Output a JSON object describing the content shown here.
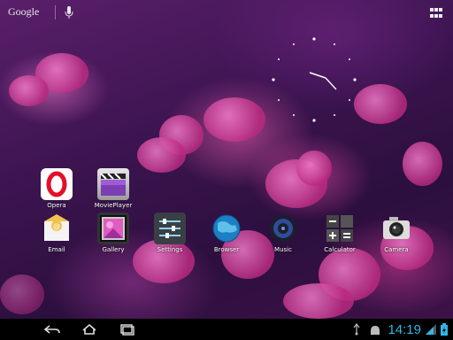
{
  "search_bar": {
    "logo_text": "Google"
  },
  "apps": [
    {
      "label": "Opera",
      "icon": "opera-icon"
    },
    {
      "label": "MoviePlayer",
      "icon": "movieplayer-icon"
    },
    {
      "label": "Email",
      "icon": "email-icon"
    },
    {
      "label": "Gallery",
      "icon": "gallery-icon"
    },
    {
      "label": "Settings",
      "icon": "settings-icon"
    },
    {
      "label": "Browser",
      "icon": "browser-icon"
    },
    {
      "label": "Music",
      "icon": "music-icon"
    },
    {
      "label": "Calculator",
      "icon": "calculator-icon"
    },
    {
      "label": "Camera",
      "icon": "camera-icon"
    }
  ],
  "status_bar": {
    "time": "14:19"
  },
  "colors": {
    "accent": "#33b5e5",
    "navbar": "#000000"
  }
}
